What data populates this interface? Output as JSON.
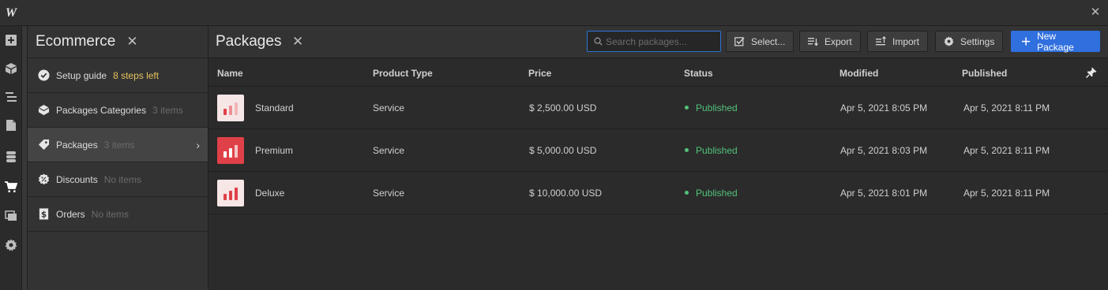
{
  "app": {
    "logo": "W"
  },
  "ecommerce": {
    "title": "Ecommerce",
    "items": [
      {
        "label": "Setup guide",
        "note": "8 steps left",
        "icon": "check-circle-icon"
      },
      {
        "label": "Packages Categories",
        "note": "3 items",
        "icon": "category-icon"
      },
      {
        "label": "Packages",
        "note": "3 items",
        "icon": "tag-icon"
      },
      {
        "label": "Discounts",
        "note": "No items",
        "icon": "discount-icon"
      },
      {
        "label": "Orders",
        "note": "No items",
        "icon": "orders-icon"
      }
    ]
  },
  "packages": {
    "title": "Packages",
    "search_placeholder": "Search packages...",
    "toolbar": {
      "select_label": "Select...",
      "export_label": "Export",
      "import_label": "Import",
      "settings_label": "Settings",
      "new_label": "New Package"
    },
    "columns": [
      "Name",
      "Product Type",
      "Price",
      "Status",
      "Modified",
      "Published"
    ],
    "rows": [
      {
        "name": "Standard",
        "type": "Service",
        "price": "$ 2,500.00 USD",
        "status": "Published",
        "modified": "Apr 5, 2021 8:05 PM",
        "published": "Apr 5, 2021 8:11 PM"
      },
      {
        "name": "Premium",
        "type": "Service",
        "price": "$ 5,000.00 USD",
        "status": "Published",
        "modified": "Apr 5, 2021 8:03 PM",
        "published": "Apr 5, 2021 8:11 PM"
      },
      {
        "name": "Deluxe",
        "type": "Service",
        "price": "$ 10,000.00 USD",
        "status": "Published",
        "modified": "Apr 5, 2021 8:01 PM",
        "published": "Apr 5, 2021 8:11 PM"
      }
    ]
  },
  "colors": {
    "accent": "#2f6fde",
    "status_green": "#52c27a",
    "warning": "#e7c25f",
    "brand_red": "#e04148"
  }
}
